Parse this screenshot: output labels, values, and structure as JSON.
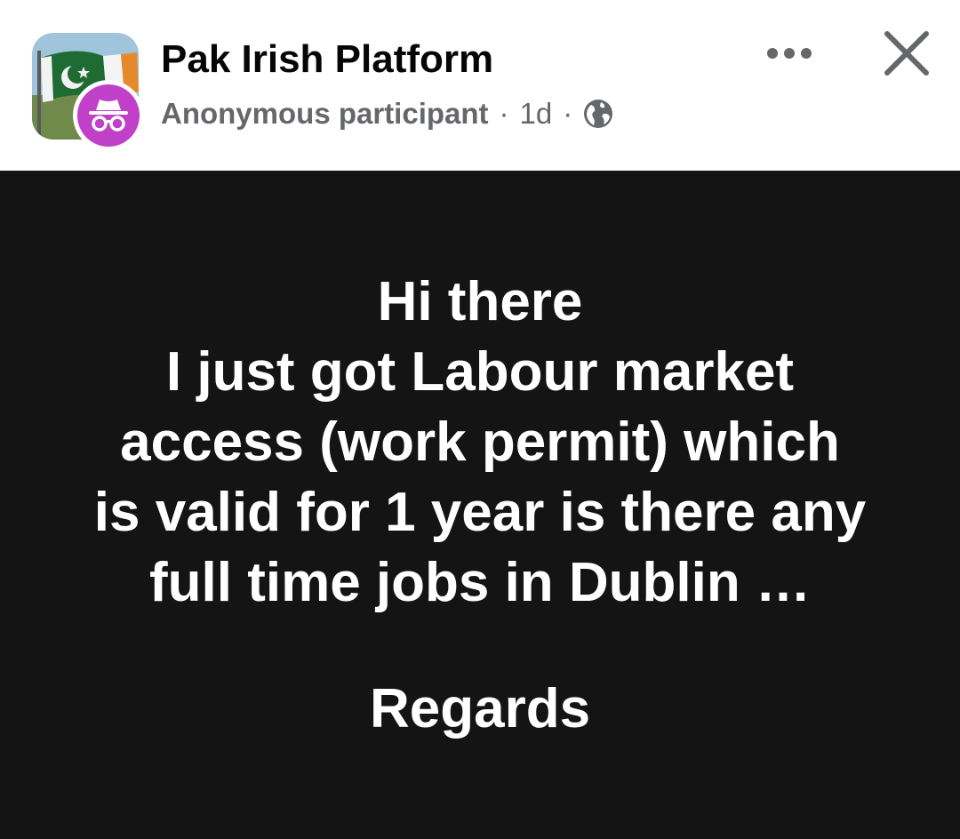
{
  "header": {
    "group_name": "Pak Irish Platform",
    "author": "Anonymous participant",
    "separator": "·",
    "time": "1d",
    "privacy_icon": "globe-icon",
    "more_icon": "more-options-icon",
    "close_icon": "close-icon",
    "avatar_badge_icon": "incognito-icon",
    "colors": {
      "badge": "#c040c8",
      "meta_text": "#65676b",
      "post_background": "#141414"
    }
  },
  "post": {
    "text": "Hi there\nI just got  Labour market\naccess (work permit) which\nis valid for 1 year is there any\nfull time jobs in Dublin …",
    "signoff": "Regards"
  }
}
